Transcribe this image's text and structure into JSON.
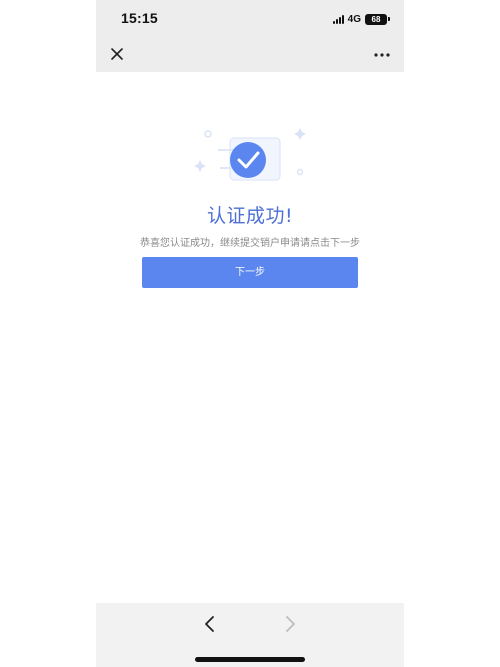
{
  "status_bar": {
    "time": "15:15",
    "network": "4G",
    "battery": "68"
  },
  "nav": {
    "close_icon": "close-icon",
    "more_icon": "more-horizontal-icon"
  },
  "hero": {
    "illustration": "success-check-icon",
    "title": "认证成功!",
    "description": "恭喜您认证成功，继续提交销户申请请点击下一步"
  },
  "actions": {
    "next_label": "下一步"
  },
  "bottom_bar": {
    "back_icon": "chevron-left-icon",
    "forward_icon": "chevron-right-icon"
  },
  "colors": {
    "accent": "#5b86f0",
    "title": "#4e70d6",
    "header_bg": "#ededed",
    "footer_bg": "#f2f2f2"
  }
}
